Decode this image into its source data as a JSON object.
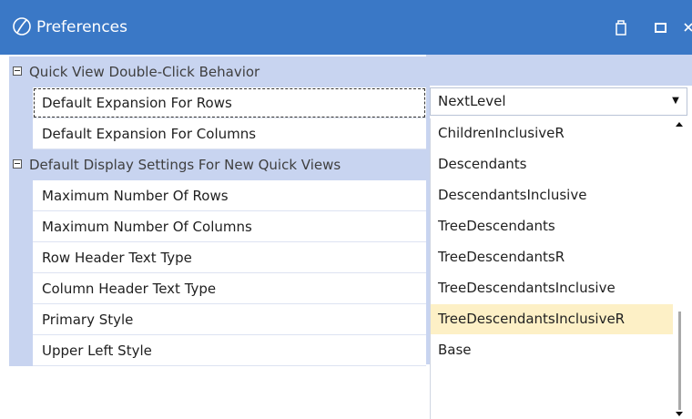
{
  "window": {
    "title": "Preferences",
    "icons": {
      "app": "app-logo-icon",
      "restore": "restore-icon",
      "maximize": "maximize-icon",
      "close": "close-icon"
    },
    "colors": {
      "titlebar": "#3a78c6",
      "category": "#c8d4f0",
      "selected": "#fdf0c6"
    }
  },
  "grid": {
    "categories": [
      {
        "label": "Quick View Double-Click Behavior",
        "properties": [
          {
            "label": "Default Expansion For Rows"
          },
          {
            "label": "Default Expansion For Columns"
          }
        ]
      },
      {
        "label": "Default Display Settings For New Quick Views",
        "properties": [
          {
            "label": "Maximum Number Of Rows"
          },
          {
            "label": "Maximum Number Of Columns"
          },
          {
            "label": "Row Header Text Type"
          },
          {
            "label": "Column Header Text Type"
          },
          {
            "label": "Primary Style"
          },
          {
            "label": "Upper Left Style"
          }
        ]
      }
    ]
  },
  "editor": {
    "combo_value": "NextLevel",
    "options": [
      "ChildrenInclusiveR",
      "Descendants",
      "DescendantsInclusive",
      "TreeDescendants",
      "TreeDescendantsR",
      "TreeDescendantsInclusive",
      "TreeDescendantsInclusiveR",
      "Base"
    ],
    "selected_option": "TreeDescendantsInclusiveR"
  }
}
